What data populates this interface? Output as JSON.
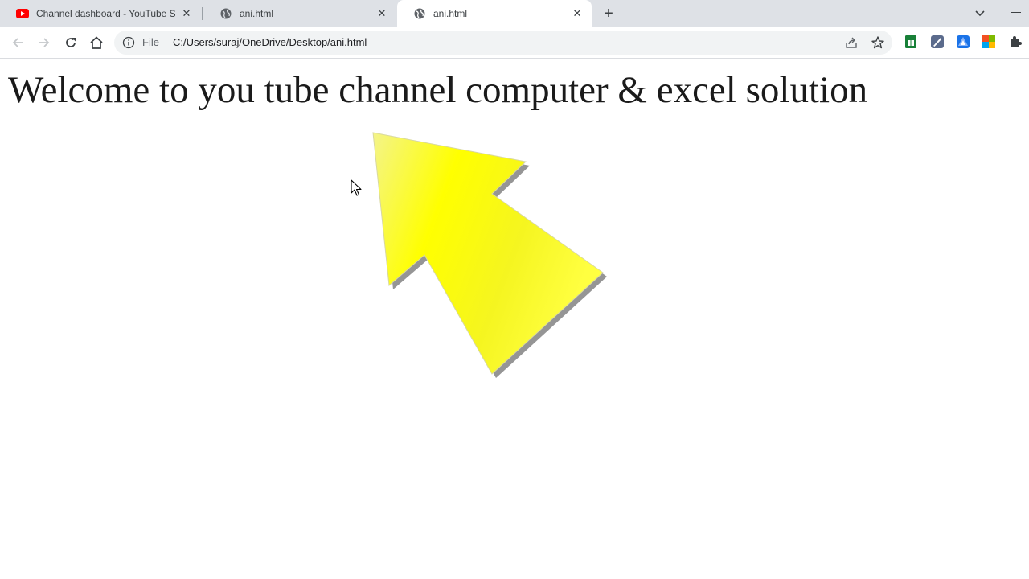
{
  "tabs": [
    {
      "title": "Channel dashboard - YouTube Studio",
      "icon": "youtube-icon",
      "active": false
    },
    {
      "title": "ani.html",
      "icon": "globe-icon",
      "active": false
    },
    {
      "title": "ani.html",
      "icon": "globe-icon",
      "active": true
    }
  ],
  "omnibox": {
    "scheme_label": "File",
    "url": "C:/Users/suraj/OneDrive/Desktop/ani.html"
  },
  "page": {
    "heading": "Welcome to you tube channel computer & excel solution"
  },
  "colors": {
    "arrow_fill": "#ffff00",
    "tabstrip_bg": "#dee1e6",
    "youtube_red": "#ff0000"
  }
}
